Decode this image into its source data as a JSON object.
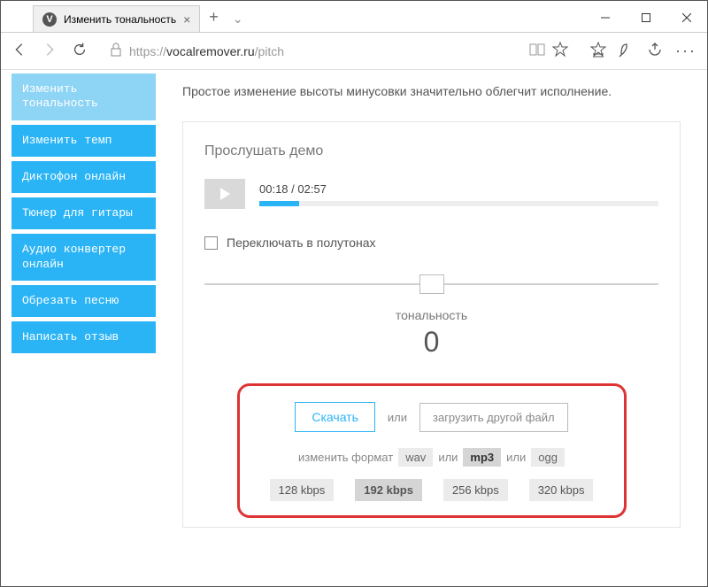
{
  "window": {
    "tab_title": "Изменить тональность",
    "url_prefix": "https://",
    "url_host": "vocalremover.ru",
    "url_path": "/pitch"
  },
  "sidebar": {
    "items": [
      {
        "label": "Изменить тональность",
        "active": true
      },
      {
        "label": "Изменить темп"
      },
      {
        "label": "Диктофон онлайн"
      },
      {
        "label": "Тюнер для гитары"
      },
      {
        "label": "Аудио конвертер онлайн"
      },
      {
        "label": "Обрезать песню"
      },
      {
        "label": "Написать отзыв"
      }
    ]
  },
  "main": {
    "intro": "Простое изменение высоты минусовки значительно облегчит исполнение.",
    "panel_title": "Прослушать демо",
    "time": "00:18 / 02:57",
    "progress_pct": 10,
    "semitone_label": "Переключать в полутонах",
    "slider_label": "тональность",
    "slider_value": "0"
  },
  "download": {
    "download_label": "Скачать",
    "or": "или",
    "upload_label": "загрузить другой файл",
    "format_label": "изменить формат",
    "formats": [
      "wav",
      "mp3",
      "ogg"
    ],
    "format_selected": "mp3",
    "bitrates": [
      "128 kbps",
      "192 kbps",
      "256 kbps",
      "320 kbps"
    ],
    "bitrate_selected": "192 kbps"
  }
}
